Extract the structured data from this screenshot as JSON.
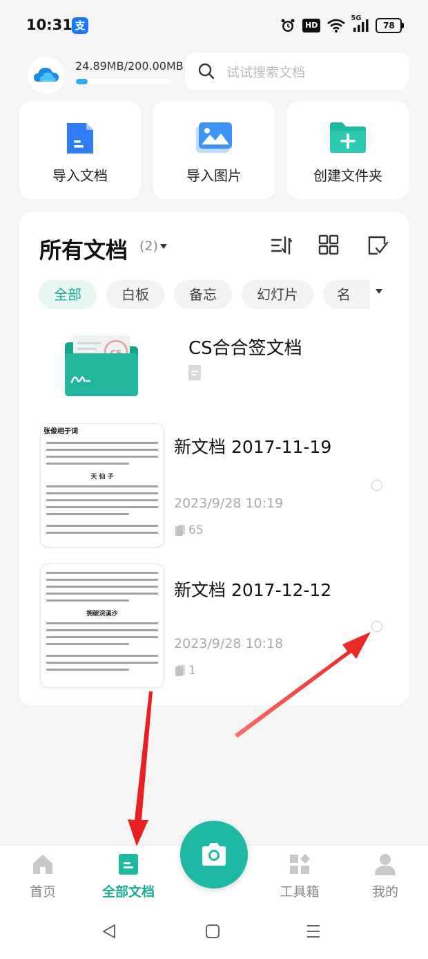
{
  "status_bar": {
    "time": "10:31",
    "alipay_glyph": "支",
    "hd": "HD",
    "network": "5G",
    "battery": "78"
  },
  "storage": {
    "text": "24.89MB/200.00MB",
    "used_fraction": 0.1245
  },
  "search": {
    "placeholder": "试试搜索文档"
  },
  "quick_actions": [
    {
      "label": "导入文档",
      "icon": "document-blue-icon"
    },
    {
      "label": "导入图片",
      "icon": "image-icon"
    },
    {
      "label": "创建文件夹",
      "icon": "folder-add-icon"
    }
  ],
  "documents": {
    "title": "所有文档",
    "count": "(2)",
    "filters": [
      "全部",
      "白板",
      "备忘",
      "幻灯片",
      "名"
    ],
    "folder": {
      "name": "CS合合签文档"
    },
    "items": [
      {
        "title": "新文档 2017-11-19",
        "date": "2023/9/28 10:19",
        "pages": "65",
        "thumb_heading": "张俊相于词",
        "thumb_sub": "天 仙 子"
      },
      {
        "title": "新文档 2017-12-12",
        "date": "2023/9/28 10:18",
        "pages": "1",
        "thumb_heading": "",
        "thumb_sub": "拥破浣溪沙"
      }
    ]
  },
  "bottom_nav": [
    {
      "label": "首页",
      "active": false
    },
    {
      "label": "全部文档",
      "active": true
    },
    {
      "label": "工具箱",
      "active": false
    },
    {
      "label": "我的",
      "active": false
    }
  ],
  "colors": {
    "accent": "#1fb8a2",
    "accent_text": "#19ad98",
    "arrow": "#e8201f",
    "storage_fill": "#34a8f3"
  }
}
